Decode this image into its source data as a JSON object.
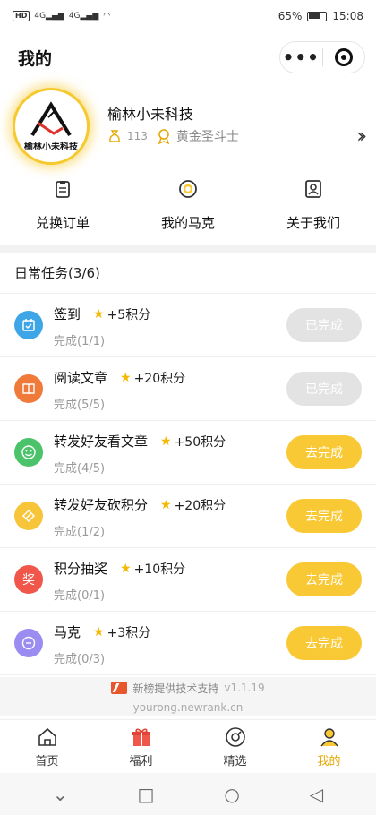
{
  "status_bar": {
    "battery": "65%",
    "time": "15:08",
    "network": [
      "HD",
      "4G",
      "4G"
    ]
  },
  "nav": {
    "title": "我的",
    "more_icon": "more-dots-icon",
    "close_icon": "close-target-icon"
  },
  "profile": {
    "avatar_text": "榆林小未科技",
    "name": "榆林小未科技",
    "points": "113",
    "rank": "黄金圣斗士"
  },
  "quick_actions": [
    {
      "label": "兑换订单",
      "icon": "order-icon"
    },
    {
      "label": "我的马克",
      "icon": "mark-icon"
    },
    {
      "label": "关于我们",
      "icon": "about-icon"
    }
  ],
  "tasks_header": "日常任务(3/6)",
  "tasks": [
    {
      "title": "签到",
      "reward": "+5积分",
      "progress": "完成(1/1)",
      "button": "已完成",
      "done": true,
      "icon": "calendar-icon",
      "color": "#3ea6e6"
    },
    {
      "title": "阅读文章",
      "reward": "+20积分",
      "progress": "完成(5/5)",
      "button": "已完成",
      "done": true,
      "icon": "book-icon",
      "color": "#f07a3a"
    },
    {
      "title": "转发好友看文章",
      "reward": "+50积分",
      "progress": "完成(4/5)",
      "button": "去完成",
      "done": false,
      "icon": "smile-icon",
      "color": "#4cc36a"
    },
    {
      "title": "转发好友砍积分",
      "reward": "+20积分",
      "progress": "完成(1/2)",
      "button": "去完成",
      "done": false,
      "icon": "ticket-icon",
      "color": "#f7c53a"
    },
    {
      "title": "积分抽奖",
      "reward": "+10积分",
      "progress": "完成(0/1)",
      "button": "去完成",
      "done": false,
      "icon": "lottery-icon",
      "color": "#f0564a",
      "icon_text": "奖"
    },
    {
      "title": "马克",
      "reward": "+3积分",
      "progress": "完成(0/3)",
      "button": "去完成",
      "done": false,
      "icon": "mark-chat-icon",
      "color": "#9a8cf0"
    }
  ],
  "footer": {
    "text": "新榜提供技术支持",
    "version": "v1.1.19",
    "url": "yourong.newrank.cn"
  },
  "tabbar": [
    {
      "label": "首页",
      "icon": "home-icon",
      "active": false
    },
    {
      "label": "福利",
      "icon": "gift-icon",
      "active": false
    },
    {
      "label": "精选",
      "icon": "compass-icon",
      "active": false
    },
    {
      "label": "我的",
      "icon": "user-icon",
      "active": true
    }
  ],
  "colors": {
    "accent": "#f9c935",
    "active_tab": "#e6a800",
    "done_button": "#e3e3e3"
  }
}
